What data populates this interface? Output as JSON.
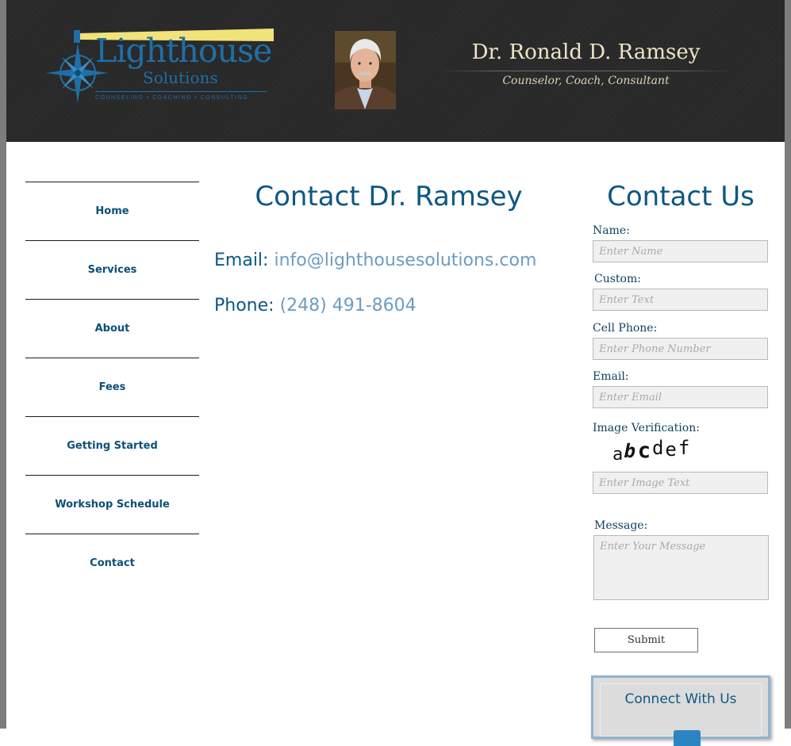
{
  "header": {
    "logo": {
      "word": "Lighthouse",
      "sub": "Solutions",
      "tagline": "COUNSELING • COACHING • CONSULTING"
    },
    "photo_alt": "Dr. Ronald D. Ramsey",
    "name": "Dr. Ronald D. Ramsey",
    "tagline": "Counselor, Coach, Consultant"
  },
  "nav": {
    "items": [
      {
        "label": "Home"
      },
      {
        "label": "Services"
      },
      {
        "label": "About"
      },
      {
        "label": "Fees"
      },
      {
        "label": "Getting Started"
      },
      {
        "label": "Workshop Schedule"
      },
      {
        "label": "Contact"
      }
    ]
  },
  "main": {
    "title": "Contact Dr. Ramsey",
    "email_label": "Email:",
    "email_value": "info@lighthousesolutions.com",
    "phone_label": "Phone:",
    "phone_value": "(248) 491-8604"
  },
  "form": {
    "title": "Contact Us",
    "name_label": "Name:",
    "name_placeholder": "Enter Name",
    "custom_label": "Custom:",
    "custom_placeholder": "Enter Text",
    "cell_label": "Cell Phone:",
    "cell_placeholder": "Enter Phone Number",
    "email_label": "Email:",
    "email_placeholder": "Enter Email",
    "verify_label": "Image Verification:",
    "captcha_chars": [
      "a",
      "b",
      "c",
      "d",
      "e",
      "f"
    ],
    "verify_placeholder": "Enter Image Text",
    "message_label": "Message:",
    "message_placeholder": "Enter Your Message",
    "submit_label": "Submit"
  },
  "connect": {
    "title": "Connect With Us"
  },
  "colors": {
    "header_bg": "#2b2b2b",
    "brand_blue": "#0c5783",
    "link_blue": "#6e9cc0",
    "logo_yellow": "#f1e27a"
  }
}
